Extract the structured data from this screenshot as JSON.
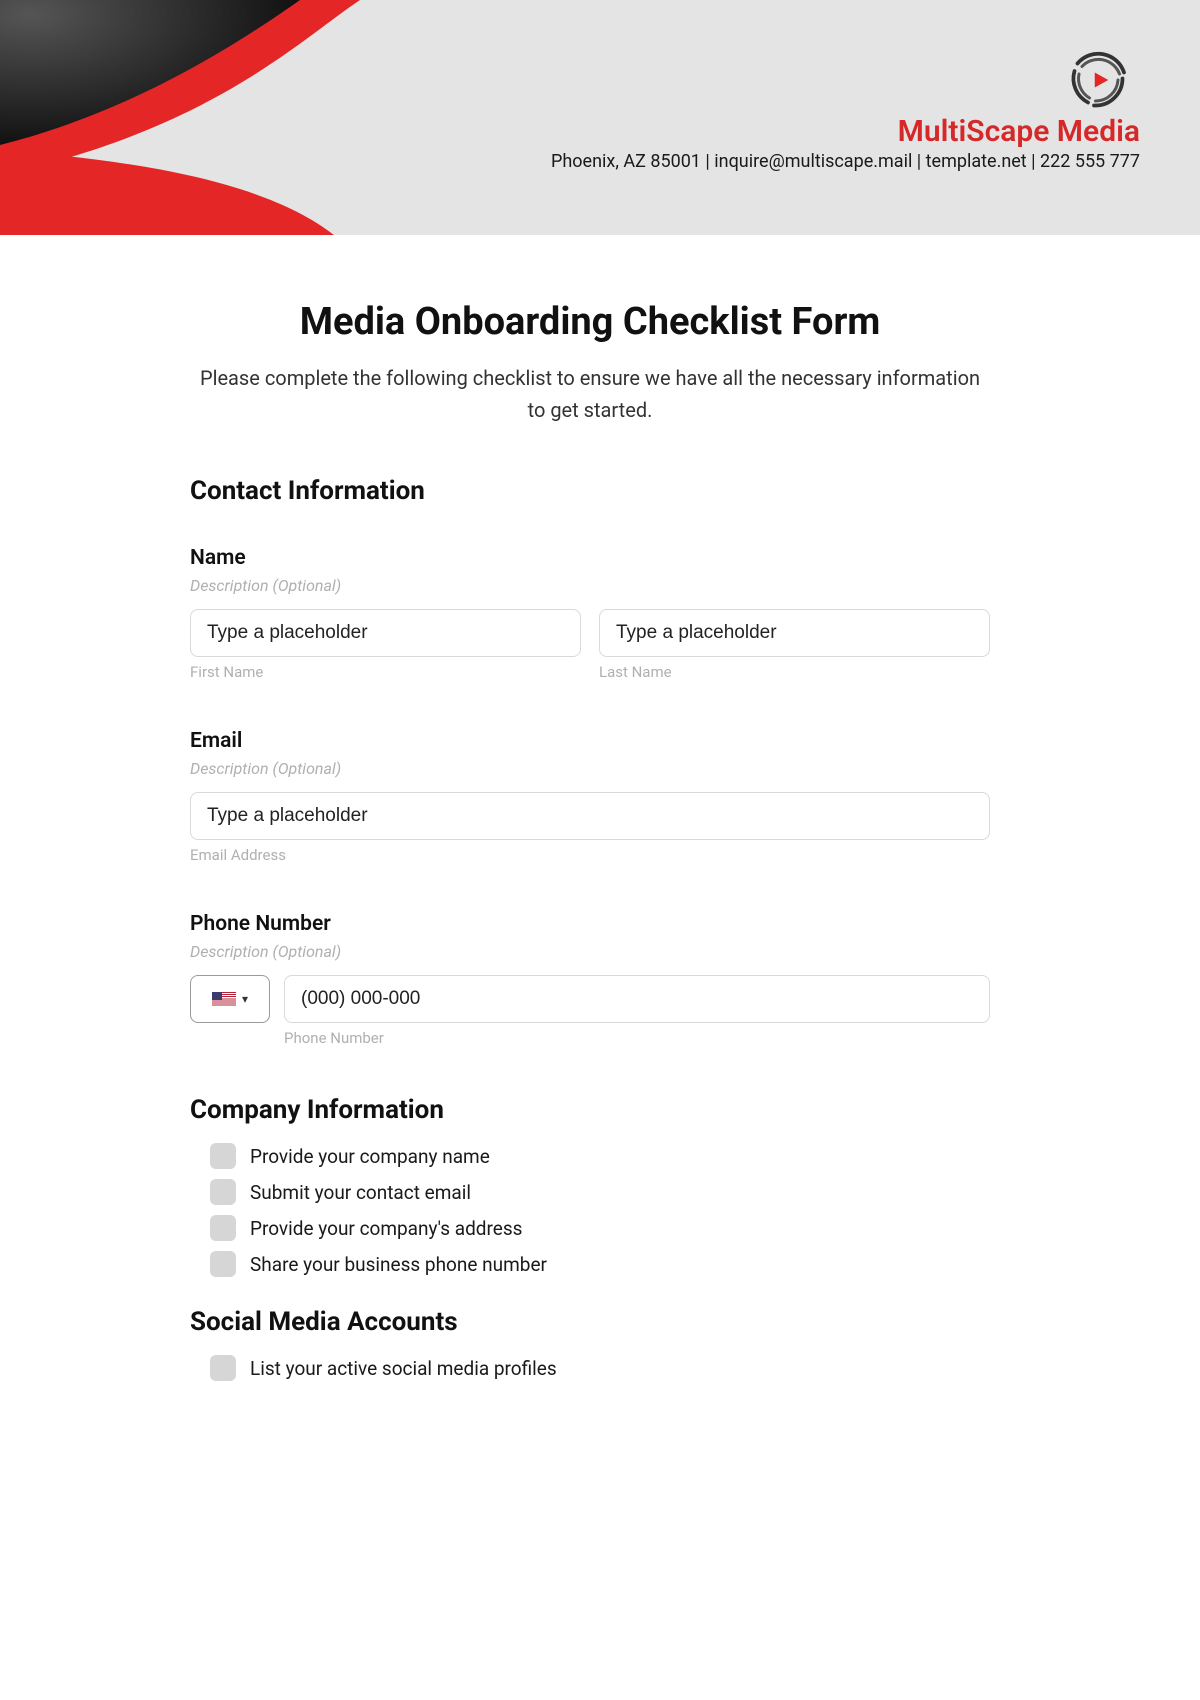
{
  "brand": {
    "name": "MultiScape Media",
    "contact": "Phoenix, AZ 85001 | inquire@multiscape.mail | template.net | 222 555 777"
  },
  "form": {
    "title": "Media Onboarding Checklist Form",
    "intro": "Please complete the following checklist to ensure we have all the necessary information to get started."
  },
  "sections": {
    "contact": {
      "title": "Contact Information",
      "name": {
        "label": "Name",
        "description": "Description (Optional)",
        "first_placeholder": "Type a placeholder",
        "first_sub": "First Name",
        "last_placeholder": "Type a placeholder",
        "last_sub": "Last Name"
      },
      "email": {
        "label": "Email",
        "description": "Description (Optional)",
        "placeholder": "Type a placeholder",
        "sub": "Email Address"
      },
      "phone": {
        "label": "Phone Number",
        "description": "Description (Optional)",
        "placeholder": "(000) 000-000",
        "sub": "Phone Number"
      }
    },
    "company": {
      "title": "Company Information",
      "items": [
        "Provide your company name",
        "Submit your contact email",
        "Provide your company's address",
        "Share your business phone number"
      ]
    },
    "social": {
      "title": "Social Media Accounts",
      "items": [
        "List your active social media profiles"
      ]
    }
  }
}
